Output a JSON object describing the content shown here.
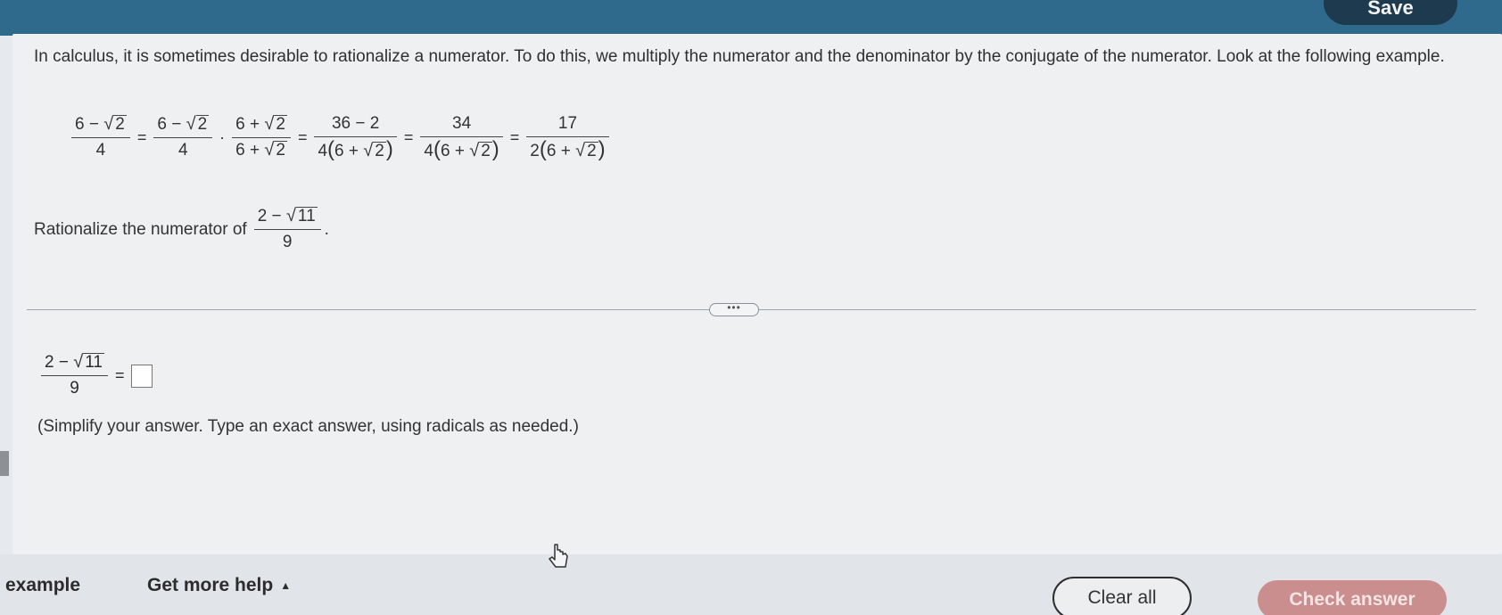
{
  "header": {
    "save_label": "Save"
  },
  "question": {
    "intro": "In calculus, it is sometimes desirable to rationalize a numerator. To do this, we multiply the numerator and the denominator by the conjugate of the numerator. Look at the following example.",
    "example": {
      "f1_num_int": "6",
      "f1_op": "−",
      "radicand": "2",
      "f1_den": "4",
      "eq": "=",
      "f2_num_int": "6",
      "f2_op": "−",
      "f2_den": "4",
      "dot": "·",
      "f3_num_int": "6",
      "f3_op": "+",
      "f3_den_int": "6",
      "f3_den_op": "+",
      "f4_num": "36 − 2",
      "f4_den_coef": "4",
      "f4_den_inner_int": "6",
      "f4_den_op": "+",
      "f5_num": "34",
      "f5_den_coef": "4",
      "f6_num": "17",
      "f6_den_coef": "2"
    },
    "prompt_text": "Rationalize the numerator of",
    "target": {
      "num_int": "2",
      "op": "−",
      "radicand": "11",
      "den": "9"
    },
    "prompt_end": "."
  },
  "more_button": "•••",
  "answer": {
    "num_int": "2",
    "op": "−",
    "radicand": "11",
    "den": "9",
    "eq": "=",
    "hint": "(Simplify your answer. Type an exact answer, using radicals as needed.)"
  },
  "footer": {
    "example_label": "example",
    "help_label": "Get more help",
    "help_caret": "▲",
    "clear_label": "Clear all",
    "check_label": "Check answer"
  },
  "colors": {
    "topbar": "#2f6a8d",
    "check_button": "#c98e8d",
    "panel": "#eef0f2"
  }
}
